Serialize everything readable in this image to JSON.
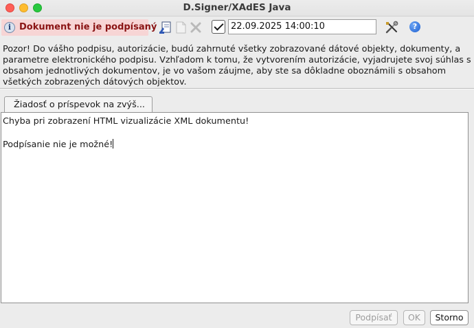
{
  "window": {
    "title": "D.Signer/XAdES Java"
  },
  "toolbar": {
    "status_text": "Dokument nie je podpísaný",
    "datetime_value": "22.09.2025 14:00:10",
    "timestamp_checked": true,
    "icons": [
      "info-icon",
      "sign-document-icon",
      "document-icon",
      "remove-icon",
      "tools-icon",
      "help-icon"
    ]
  },
  "warning_text": "Pozor! Do vášho podpisu, autorizácie, budú zahrnuté všetky zobrazované dátové objekty, dokumenty, a parametre elektronického podpisu. Vzhľadom k tomu, že vytvorením autorizácie, vyjadrujete svoj súhlas s obsahom jednotlivých dokumentov, je vo vašom záujme, aby ste sa dôkladne oboznámili s obsahom všetkých zobrazených dátových objektov.",
  "tabs": [
    {
      "label": "Žiadosť o príspevok na zvýš..."
    }
  ],
  "content": {
    "error_line1": "Chyba pri zobrazení HTML vizualizácie XML dokumentu!",
    "error_line2": "Podpísanie nie je možné!"
  },
  "buttons": {
    "sign": "Podpísať",
    "ok": "OK",
    "cancel": "Storno"
  },
  "colors": {
    "status_bg": "#f7d5d5",
    "status_text": "#8a1414",
    "help_blue": "#1d5fd0"
  }
}
